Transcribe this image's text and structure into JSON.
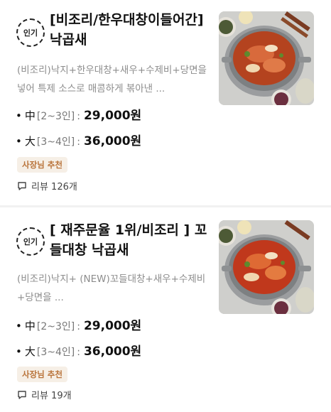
{
  "menu_items": [
    {
      "badge": "인기",
      "title": "[비조리/한우대창이들어간] 낙곱새",
      "description": "(비조리)낙지+한우대창+새우+수제비+당면을 넣어  특제 소스로 매콤하게 볶아낸 ...",
      "options": [
        {
          "bullet": "•",
          "size": "中",
          "serves": "[2~3인]",
          "colon": ":",
          "price": "29,000원"
        },
        {
          "bullet": "•",
          "size": "大",
          "serves": "[3~4인]",
          "colon": ":",
          "price": "36,000원"
        }
      ],
      "recommend_badge": "사장님 추천",
      "reviews": "리뷰 126개"
    },
    {
      "badge": "인기",
      "title": "[ 재주문율 1위/비조리 ] 꼬들대창 낙곱새",
      "description": "(비조리)낙지+ (NEW)꼬들대창+새우+수제비+당면을 ...",
      "options": [
        {
          "bullet": "•",
          "size": "中",
          "serves": "[2~3인]",
          "colon": ":",
          "price": "29,000원"
        },
        {
          "bullet": "•",
          "size": "大",
          "serves": "[3~4인]",
          "colon": ":",
          "price": "36,000원"
        }
      ],
      "recommend_badge": "사장님 추천",
      "reviews": "리뷰 19개"
    }
  ],
  "colors": {
    "recommend_bg": "#f6efe6",
    "recommend_text": "#b9733a",
    "description_text": "#8d8d8d"
  },
  "icons": {
    "popular": "dashed-circle-badge",
    "reviews": "speech-bubble-icon",
    "thumbnail": "spicy-stew-pan-photo"
  }
}
